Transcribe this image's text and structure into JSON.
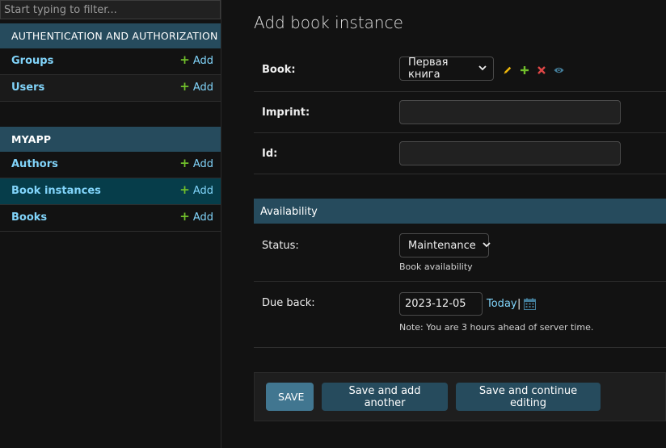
{
  "sidebar": {
    "filter_placeholder": "Start typing to filter...",
    "modules": [
      {
        "caption": "AUTHENTICATION AND AUTHORIZATION",
        "models": [
          {
            "label": "Groups",
            "add_label": "Add"
          },
          {
            "label": "Users",
            "add_label": "Add"
          }
        ]
      },
      {
        "caption": "MYAPP",
        "models": [
          {
            "label": "Authors",
            "add_label": "Add"
          },
          {
            "label": "Book instances",
            "add_label": "Add",
            "current": true
          },
          {
            "label": "Books",
            "add_label": "Add"
          }
        ]
      }
    ]
  },
  "main": {
    "title": "Add book instance",
    "fields": {
      "book": {
        "label": "Book:",
        "selected": "Первая книга"
      },
      "imprint": {
        "label": "Imprint:",
        "value": ""
      },
      "id": {
        "label": "Id:",
        "value": ""
      }
    },
    "availability": {
      "heading": "Availability",
      "status": {
        "label": "Status:",
        "selected": "Maintenance",
        "help": "Book availability"
      },
      "due_back": {
        "label": "Due back:",
        "value": "2023-12-05",
        "today_label": "Today",
        "separator": "|",
        "note": "Note: You are 3 hours ahead of server time."
      }
    },
    "buttons": {
      "save": "SAVE",
      "save_add_another": "Save and add another",
      "save_continue": "Save and continue editing"
    }
  },
  "icons": {
    "plus": "plus-icon",
    "pencil": "pencil-icon",
    "delete": "delete-icon",
    "view": "eye-icon",
    "calendar": "calendar-icon"
  },
  "colors": {
    "accent_header": "#264b5d",
    "link": "#81d4fa",
    "add_green": "#70bf2b",
    "save_button": "#417690",
    "current_row": "#063d4a"
  }
}
